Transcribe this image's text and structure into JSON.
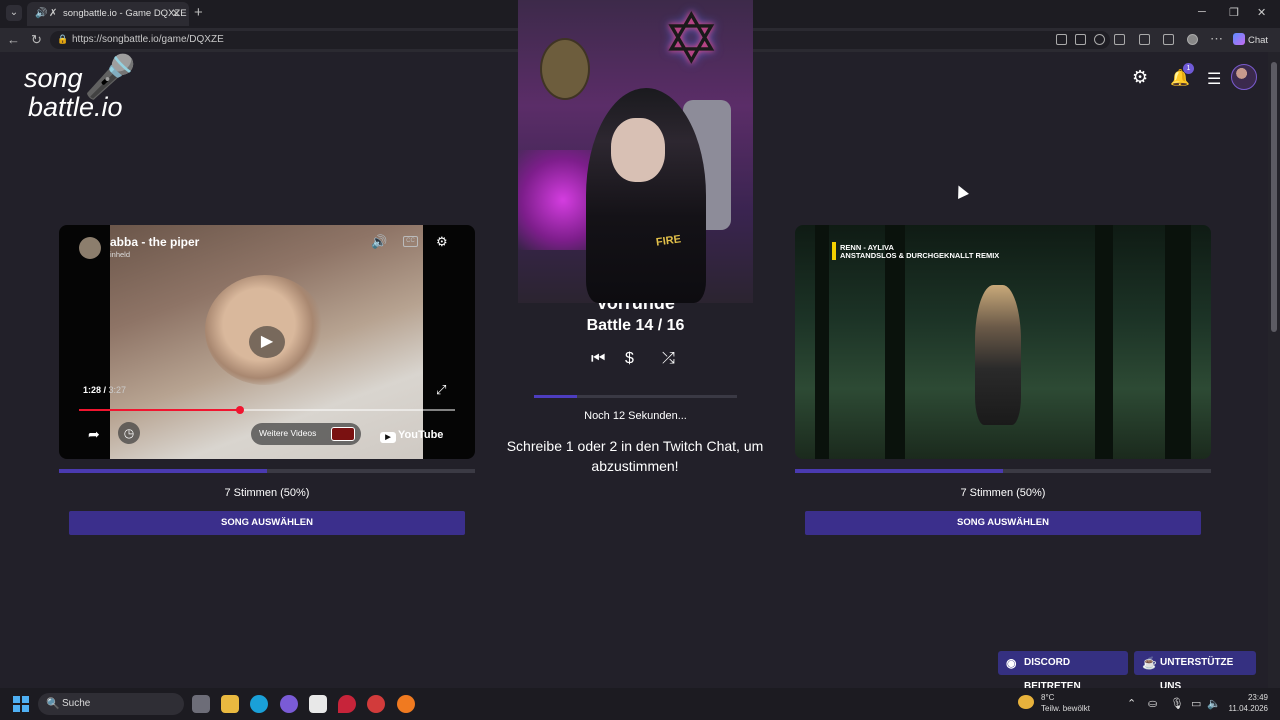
{
  "browser": {
    "tab_title": "songbattle.io - Game DQXZE",
    "url": "https://songbattle.io/game/DQXZE",
    "chat_label": "Chat"
  },
  "header": {
    "logo_line1": "song",
    "logo_line2": "battle.io",
    "notification_count": "1"
  },
  "left_song": {
    "title": "abba - the piper",
    "channel": "inheld",
    "time_current": "1:28",
    "time_total": "3:27",
    "progress": 0.428,
    "more_videos_label": "Weitere Videos",
    "youtube_label": "YouTube",
    "votes_text": "7 Stimmen (50%)",
    "vote_share": 0.5,
    "select_label": "SONG AUSWÄHLEN"
  },
  "right_song": {
    "overlay_line1": "RENN - AYLIVA",
    "overlay_line2": "ANSTANDSLOS & DURCHGEKNALLT REMIX",
    "votes_text": "7 Stimmen (50%)",
    "vote_share": 0.5,
    "select_label": "SONG AUSWÄHLEN"
  },
  "center": {
    "round_label": "Vorrunde",
    "battle_label": "Battle 14 / 16",
    "countdown": "Noch 12 Sekunden...",
    "countdown_share": 0.21,
    "instruction": "Schreibe 1 oder 2 in den Twitch Chat, um abzustimmen!",
    "webcam_shirt_text": "FIRE"
  },
  "footer": {
    "discord_label": "DISCORD BEITRETEN",
    "support_label": "UNTERSTÜTZE UNS"
  },
  "taskbar": {
    "search_placeholder": "Suche",
    "temperature": "8°C",
    "weather": "Teilw. bewölkt",
    "time": "23:49",
    "date": "11.04.2026"
  },
  "colors": {
    "accent": "#3b2f8c",
    "background": "#222029",
    "seek": "#f0152f"
  }
}
